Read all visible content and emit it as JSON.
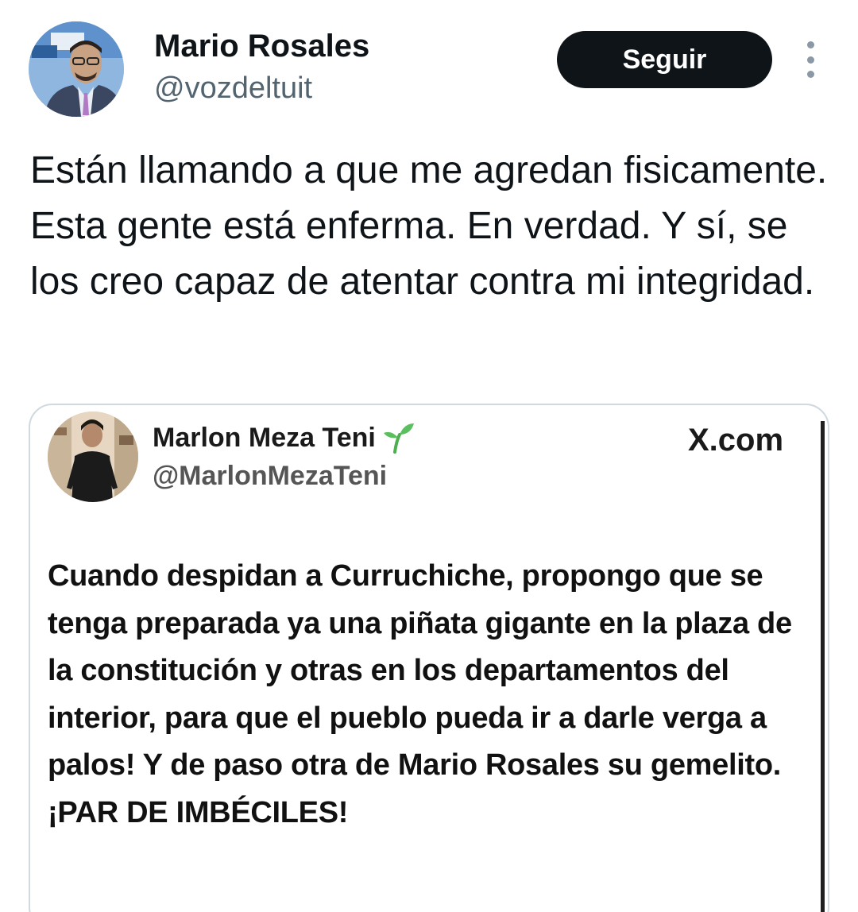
{
  "tweet": {
    "author": {
      "name": "Mario Rosales",
      "handle": "@vozdeltuit"
    },
    "follow_label": "Seguir",
    "text": "Están llamando a que me agredan fisicamente. Esta gente está enferma. En verdad. Y sí, se los creo capaz de atentar contra mi integridad.",
    "media": {
      "quoted_author": {
        "name": "Marlon Meza Teni",
        "handle": "@MarlonMezaTeni",
        "name_emoji": "sprout"
      },
      "source_label": "X.com",
      "quoted_text": "Cuando despidan a Curruchiche, propongo que se tenga preparada ya una piñata gigante en la plaza de la constitución y otras en los departamentos del interior, para que el pueblo pueda ir a darle verga a palos! Y de paso otra de Mario Rosales su gemelito. ¡PAR DE IMBÉCILES!"
    }
  },
  "icons": {
    "more": "more-vertical-icon",
    "sprout": "sprout-icon"
  },
  "colors": {
    "follow_button_bg": "#0f1419",
    "follow_button_text": "#ffffff",
    "handle_text": "#536471",
    "card_border": "#cfd9de",
    "sprout_green": "#4caf50"
  }
}
